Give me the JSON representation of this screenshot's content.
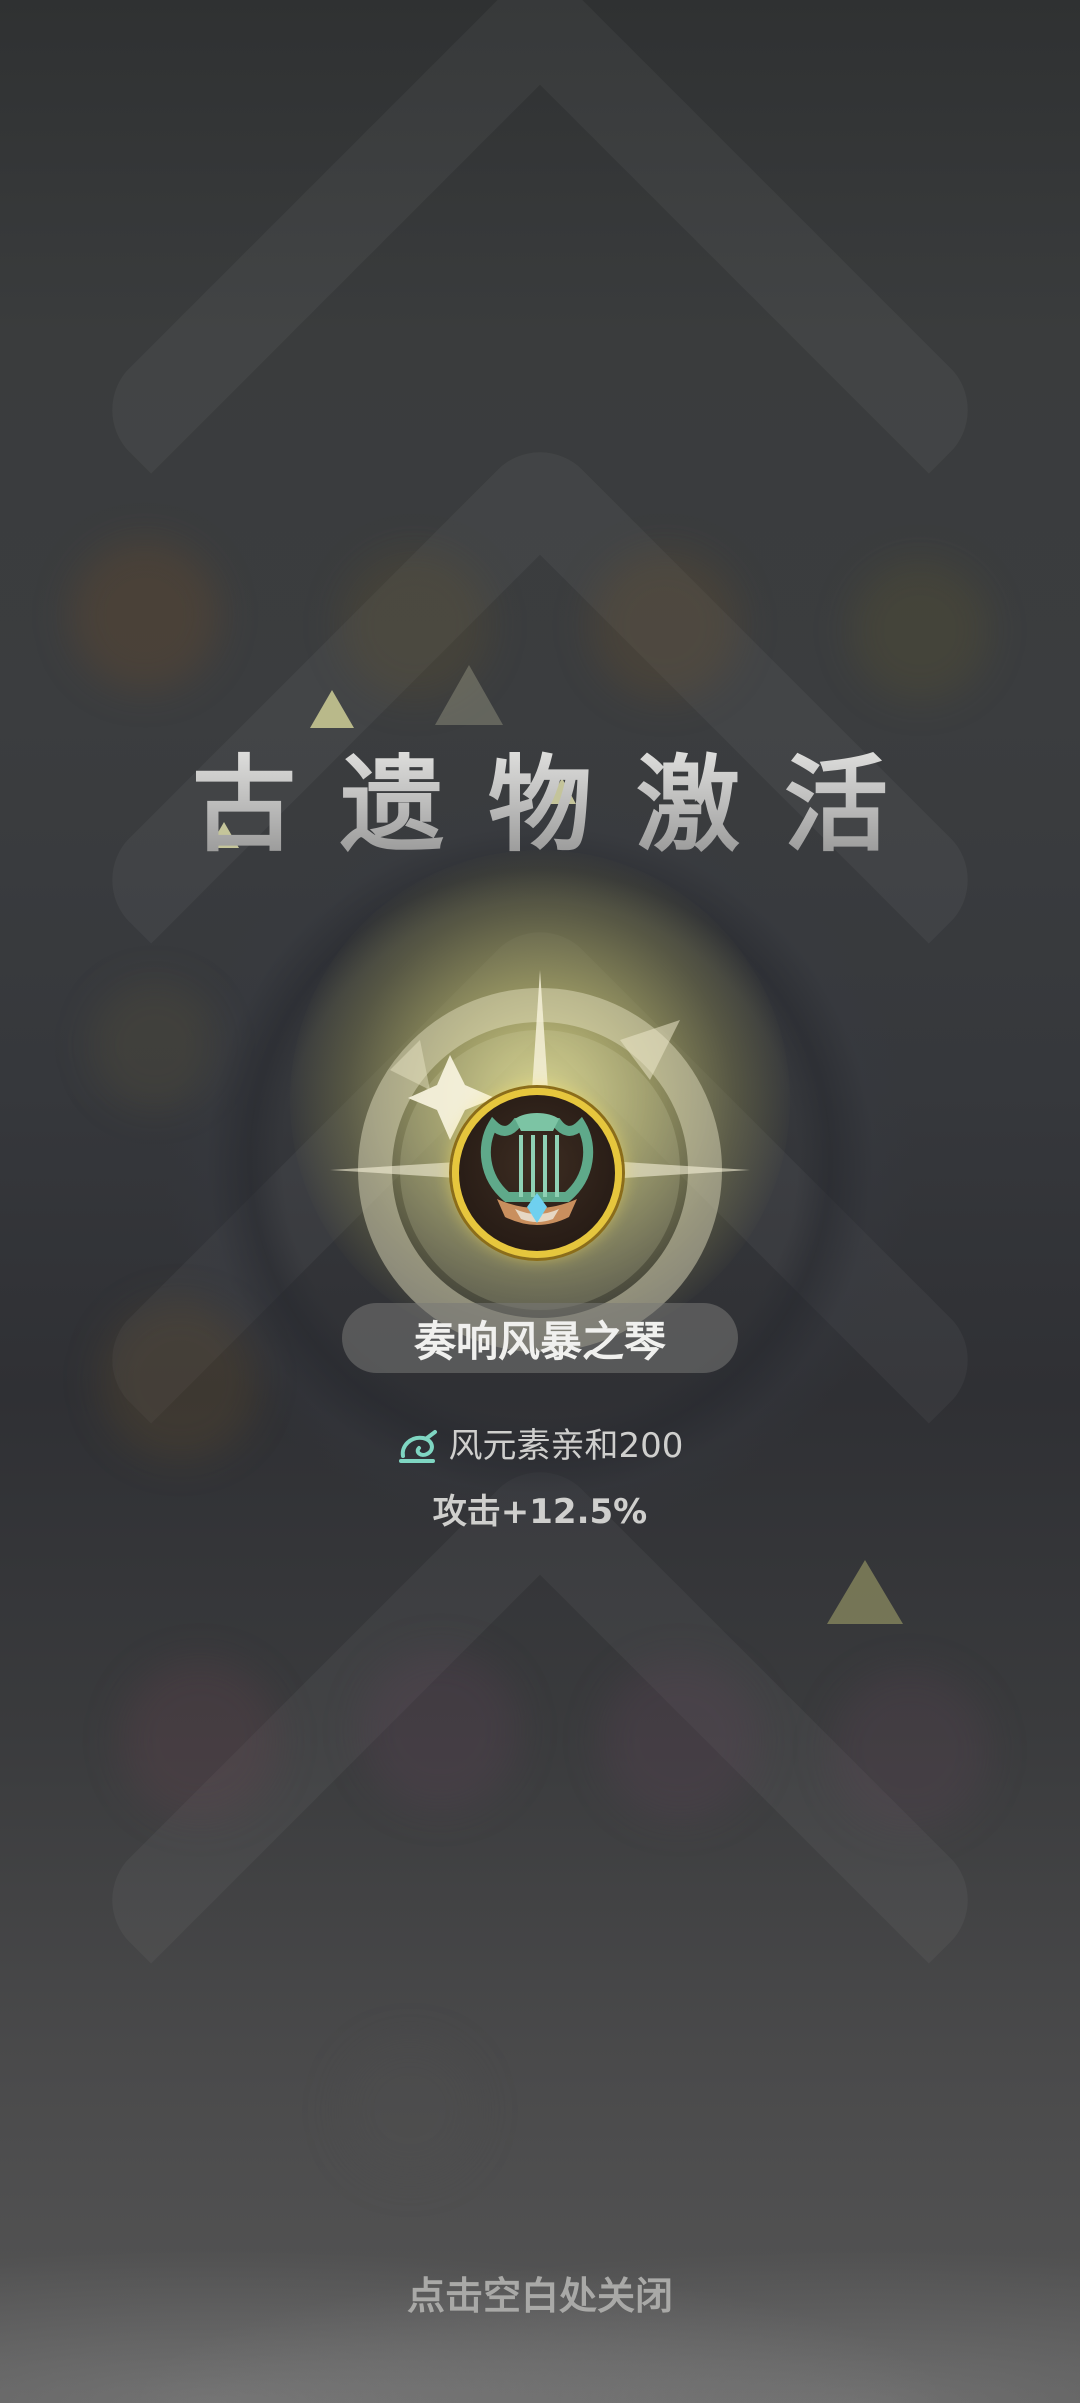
{
  "screen": {
    "title": "古遗物激活",
    "relic": {
      "name": "奏响风暴之琴",
      "icon": "lyre-icon"
    },
    "stats": [
      {
        "icon": "wind-element-icon",
        "text": "风元素亲和200"
      },
      {
        "text": "攻击+12.5%"
      }
    ],
    "close_hint": "点击空白处关闭"
  },
  "colors": {
    "accent_gold": "#e6c63d",
    "glow": "#f0eb96",
    "wind_teal": "#7fd6c2"
  }
}
